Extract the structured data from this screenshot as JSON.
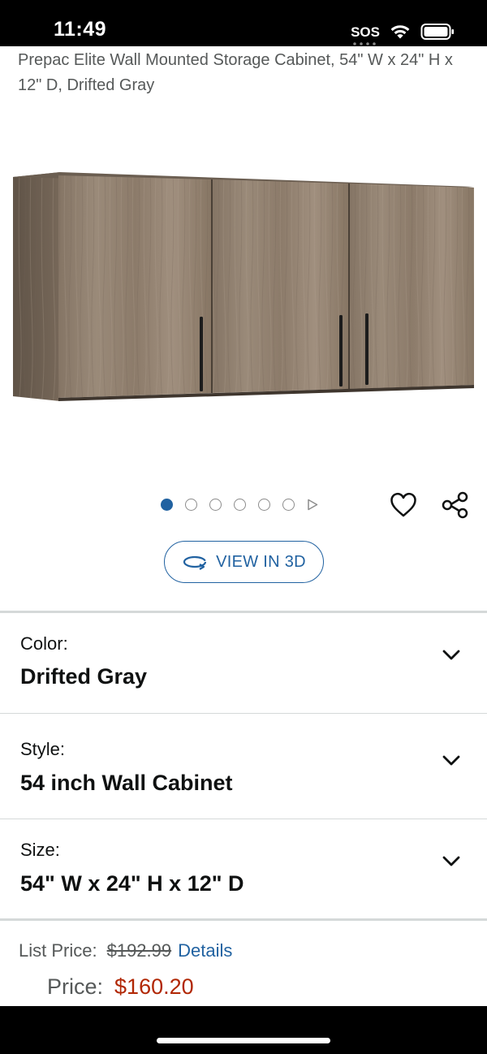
{
  "status": {
    "time": "11:49",
    "sos": "SOS",
    "icons": [
      "cellular-sos-icon",
      "wifi-icon",
      "battery-icon"
    ]
  },
  "product": {
    "title": "Prepac Elite Wall Mounted Storage Cabinet, 54\" W x 24\" H x 12\" D, Drifted Gray",
    "image_alt": "3-door wall cabinet in drifted gray wood finish",
    "image_count": 6,
    "active_image": 1
  },
  "actions": {
    "view3d_label": "VIEW IN 3D",
    "icons": [
      "heart-icon",
      "share-icon",
      "rotate-3d-icon"
    ]
  },
  "variations": [
    {
      "label": "Color:",
      "value": "Drifted Gray"
    },
    {
      "label": "Style:",
      "value": "54 inch Wall Cabinet"
    },
    {
      "label": "Size:",
      "value": "54\" W x 24\" H x 12\" D"
    }
  ],
  "pricing": {
    "list_price_label": "List Price:",
    "list_price": "$192.99",
    "details_link": "Details",
    "price_label": "Price:",
    "price": "$160.20"
  },
  "colors": {
    "link_blue": "#2162a1",
    "price_red": "#b12704",
    "muted_text": "#565959",
    "divider": "#d5d9d9"
  }
}
